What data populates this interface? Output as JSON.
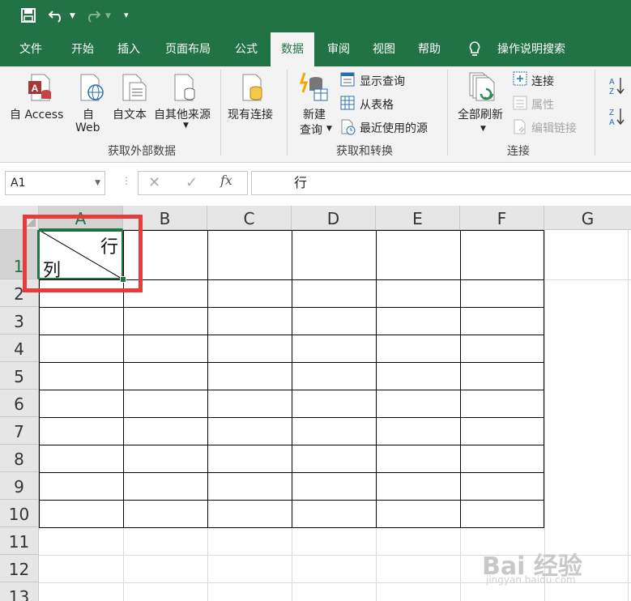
{
  "quick_access": {
    "save_icon": "save-icon",
    "undo_icon": "undo-icon",
    "redo_icon": "redo-icon",
    "customize_icon": "customize-qat-icon"
  },
  "tabs": [
    {
      "label": "文件",
      "active": false
    },
    {
      "label": "开始",
      "active": false
    },
    {
      "label": "插入",
      "active": false
    },
    {
      "label": "页面布局",
      "active": false
    },
    {
      "label": "公式",
      "active": false
    },
    {
      "label": "数据",
      "active": true
    },
    {
      "label": "审阅",
      "active": false
    },
    {
      "label": "视图",
      "active": false
    },
    {
      "label": "帮助",
      "active": false
    }
  ],
  "tell_me": "操作说明搜索",
  "ribbon": {
    "get_external": {
      "from_access": "自 Access",
      "from_web_1": "自",
      "from_web_2": "Web",
      "from_text": "自文本",
      "from_other": "自其他来源",
      "group_label": "获取外部数据"
    },
    "existing_connections": "现有连接",
    "get_transform": {
      "new_query_1": "新建",
      "new_query_2": "查询",
      "show_queries": "显示查询",
      "from_table": "从表格",
      "recent_sources": "最近使用的源",
      "group_label": "获取和转换"
    },
    "connections": {
      "refresh_all": "全部刷新",
      "connections": "连接",
      "properties": "属性",
      "edit_links": "编辑链接",
      "group_label": "连接"
    }
  },
  "formula_bar": {
    "name_box": "A1",
    "cancel": "✕",
    "enter": "✓",
    "fx": "fx",
    "content": "行"
  },
  "sheet": {
    "columns": [
      "A",
      "B",
      "C",
      "D",
      "E",
      "F",
      "G"
    ],
    "rows": [
      "1",
      "2",
      "3",
      "4",
      "5",
      "6",
      "7",
      "8",
      "9",
      "10",
      "11",
      "12",
      "13"
    ],
    "cell_a1_top_right": "行",
    "cell_a1_bottom_left": "列"
  },
  "watermark": {
    "text": "Bai 经验",
    "sub": "jingyan.baidu.com"
  },
  "colors": {
    "accent": "#217346",
    "highlight_box": "#e83b3b"
  }
}
